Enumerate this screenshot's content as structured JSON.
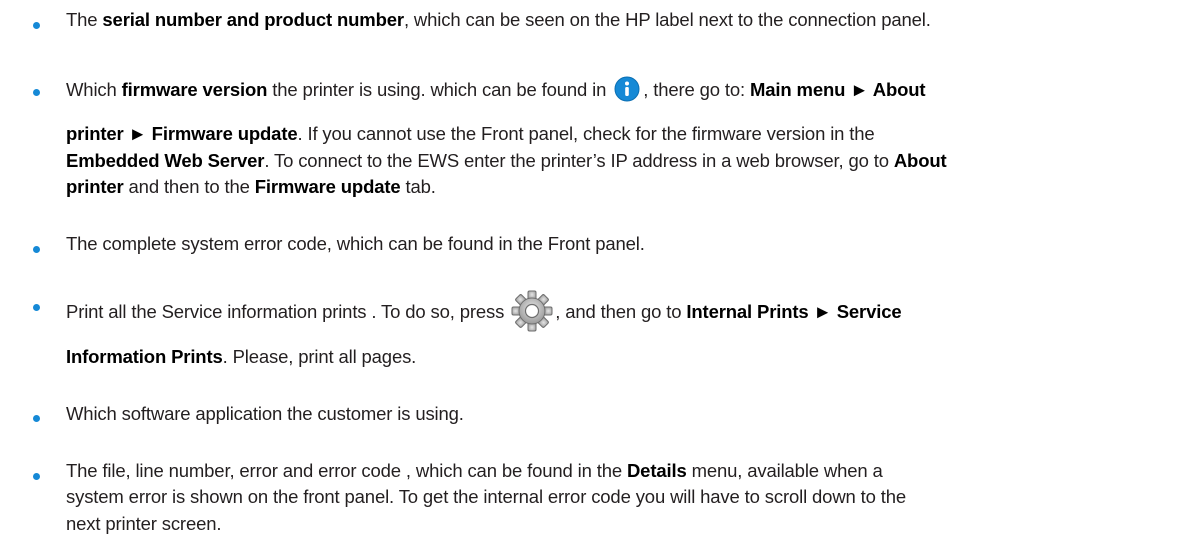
{
  "items": [
    {
      "line1": {
        "t1": "The ",
        "b1": "serial number and product number",
        "t2": ", which can be seen on the HP label next to the connection panel."
      }
    },
    {
      "line1": {
        "t1": "Which ",
        "b1": "firmware version",
        "t2": " the printer is using. which can be found in ",
        "t3": ", there go to: ",
        "b2": "Main menu ► About"
      },
      "line2": {
        "b1": "printer ► Firmware update",
        "t1": ". If you cannot use the Front panel, check for the firmware version in the"
      },
      "line3": {
        "b1": "Embedded Web Server",
        "t1": ". To connect to the EWS enter the printer’s IP address in a web browser, go to ",
        "b2": "About"
      },
      "line4": {
        "b1": "printer",
        "t1": " and then to the ",
        "b2": "Firmware update",
        "t2": " tab."
      }
    },
    {
      "line1": {
        "t1": "The complete system error code, which can be found in the Front panel."
      }
    },
    {
      "line1": {
        "t1": "Print all the Service information prints . To do so, press ",
        "t2": ", and then go to ",
        "b1": "Internal Prints ► Service"
      },
      "line2": {
        "b1": "Information Prints",
        "t1": ". Please, print all pages."
      }
    },
    {
      "line1": {
        "t1": "Which software application the customer is using."
      }
    },
    {
      "line1": {
        "t1": "The file, line number, error and error code , which can be found in the ",
        "b1": "Details",
        "t2": " menu, available when a"
      },
      "line2": {
        "t1": "system error is shown on the front panel. To get the internal error code you will have to scroll down to the"
      },
      "line3": {
        "t1": "next printer screen."
      }
    }
  ],
  "colors": {
    "bullet": "#1589d6",
    "text": "#231f20",
    "info_icon": "#1589d6"
  },
  "icons": [
    "info-icon",
    "gear-icon"
  ]
}
